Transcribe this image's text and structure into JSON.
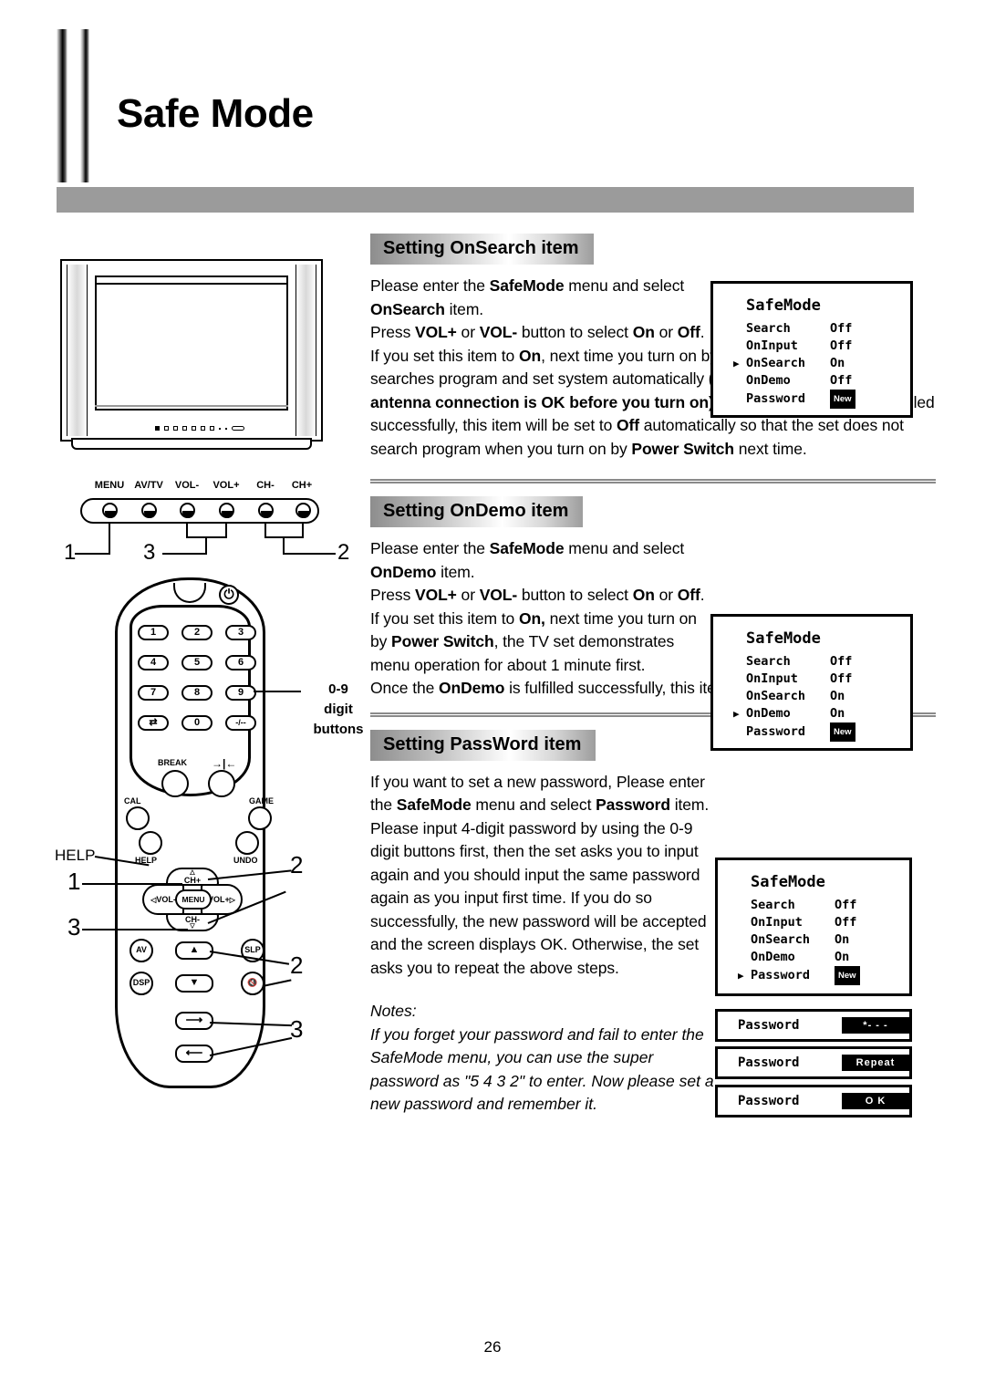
{
  "header": {
    "title": "Safe Mode"
  },
  "illustration": {
    "tv": {
      "button_labels": [
        "MENU",
        "AV/TV",
        "VOL-",
        "VOL+",
        "CH-",
        "CH+"
      ],
      "callouts": [
        "1",
        "3",
        "2"
      ]
    },
    "remote": {
      "digit_buttons_label_line1": "0-9",
      "digit_buttons_label_line2": "digit",
      "digit_buttons_label_line3": "buttons",
      "number_buttons": [
        "1",
        "2",
        "3",
        "4",
        "5",
        "6",
        "7",
        "8",
        "9",
        "0",
        "-/--"
      ],
      "swap_button": "swap-icon",
      "power_button": "power-icon",
      "break_button": "BREAK",
      "freeze_button": "freeze-icon",
      "cal_button": "CAL",
      "game_button": "GAME",
      "help_button": "HELP",
      "undo_button": "UNDO",
      "help_external_label": "HELP",
      "dpad": {
        "up": "CH+",
        "down": "CH-",
        "left": "VOL-",
        "right": "VOL+",
        "center": "MENU"
      },
      "av_button": "AV",
      "dsp_button": "DSP",
      "slp_button": "SLP",
      "mute_button": "mute-icon",
      "up_arrow_button": "up-arrow-icon",
      "down_arrow_button": "down-arrow-icon",
      "right_arrow_button": "right-arrow-icon",
      "left_arrow_button": "left-arrow-icon",
      "callouts": [
        "1",
        "3",
        "2",
        "2",
        "3"
      ]
    }
  },
  "sections": [
    {
      "heading": "Setting OnSearch item",
      "paragraphs": [
        "Please enter the <b>SafeMode</b> menu and select <b>OnSearch</b> item.",
        "Press <b>VOL+</b> or <b>VOL-</b> button to select <b>On</b> or <b>Off</b>.",
        "If you set this item to <b>On</b>, next time you turn on by <b>Power Switch</b>, the TV set searches program and set system automatically <b>(please make sure that the antenna connection is OK before you turn on)</b>. Once the <b>OnSearch</b> is fulfilled successfully, this item will be set to <b>Off</b> automatically so that the set does not search program when you turn on by <b>Power Switch</b> next time."
      ]
    },
    {
      "heading": "Setting OnDemo item",
      "paragraphs": [
        "Please enter the <b>SafeMode</b> menu and select <b>OnDemo</b> item.",
        "Press <b>VOL+</b> or <b>VOL-</b> button to select <b>On</b> or <b>Off</b>.",
        "If you set this item to <b>On,</b> next time you turn on by <b>Power Switch</b>, the TV set demonstrates menu operation for about 1 minute first.",
        "Once the <b>OnDemo</b> is fulfilled successfully, this item will be set <b>Off</b>."
      ]
    },
    {
      "heading": "Setting PassWord item",
      "paragraphs": [
        "If you want to set a new password, Please enter the <b>SafeMode</b> menu and select <b>Password</b> item.",
        "Please input 4-digit password by using the 0-9 digit buttons first, then the set asks you to input again and you should input the same password again as you input first time. If you do so successfully, the new password will be accepted and the screen displays OK. Otherwise, the set asks you to repeat the above steps."
      ]
    }
  ],
  "notes": {
    "label": "Notes:",
    "text": "If you forget your password and fail to enter the SafeMode menu, you can use the super password as \"5 4 3 2\" to enter. Now please set a new password and remember it."
  },
  "osd_menus": [
    {
      "title": "SafeMode",
      "selected": "OnSearch",
      "rows": [
        {
          "name": "Search",
          "value": "Off",
          "badge": false
        },
        {
          "name": "OnInput",
          "value": "Off",
          "badge": false
        },
        {
          "name": "OnSearch",
          "value": "On",
          "badge": false
        },
        {
          "name": "OnDemo",
          "value": "Off",
          "badge": false
        },
        {
          "name": "Password",
          "value": "New",
          "badge": true
        }
      ]
    },
    {
      "title": "SafeMode",
      "selected": "OnDemo",
      "rows": [
        {
          "name": "Search",
          "value": "Off",
          "badge": false
        },
        {
          "name": "OnInput",
          "value": "Off",
          "badge": false
        },
        {
          "name": "OnSearch",
          "value": "On",
          "badge": false
        },
        {
          "name": "OnDemo",
          "value": "On",
          "badge": false
        },
        {
          "name": "Password",
          "value": "New",
          "badge": true
        }
      ]
    },
    {
      "title": "SafeMode",
      "selected": "Password",
      "rows": [
        {
          "name": "Search",
          "value": "Off",
          "badge": false
        },
        {
          "name": "OnInput",
          "value": "Off",
          "badge": false
        },
        {
          "name": "OnSearch",
          "value": "On",
          "badge": false
        },
        {
          "name": "OnDemo",
          "value": "On",
          "badge": false
        },
        {
          "name": "Password",
          "value": "New",
          "badge": true
        }
      ]
    }
  ],
  "password_dialogs": [
    {
      "label": "Password",
      "value": "*- - -"
    },
    {
      "label": "Password",
      "value": "Repeat"
    },
    {
      "label": "Password",
      "value": "O K"
    }
  ],
  "page_number": "26"
}
